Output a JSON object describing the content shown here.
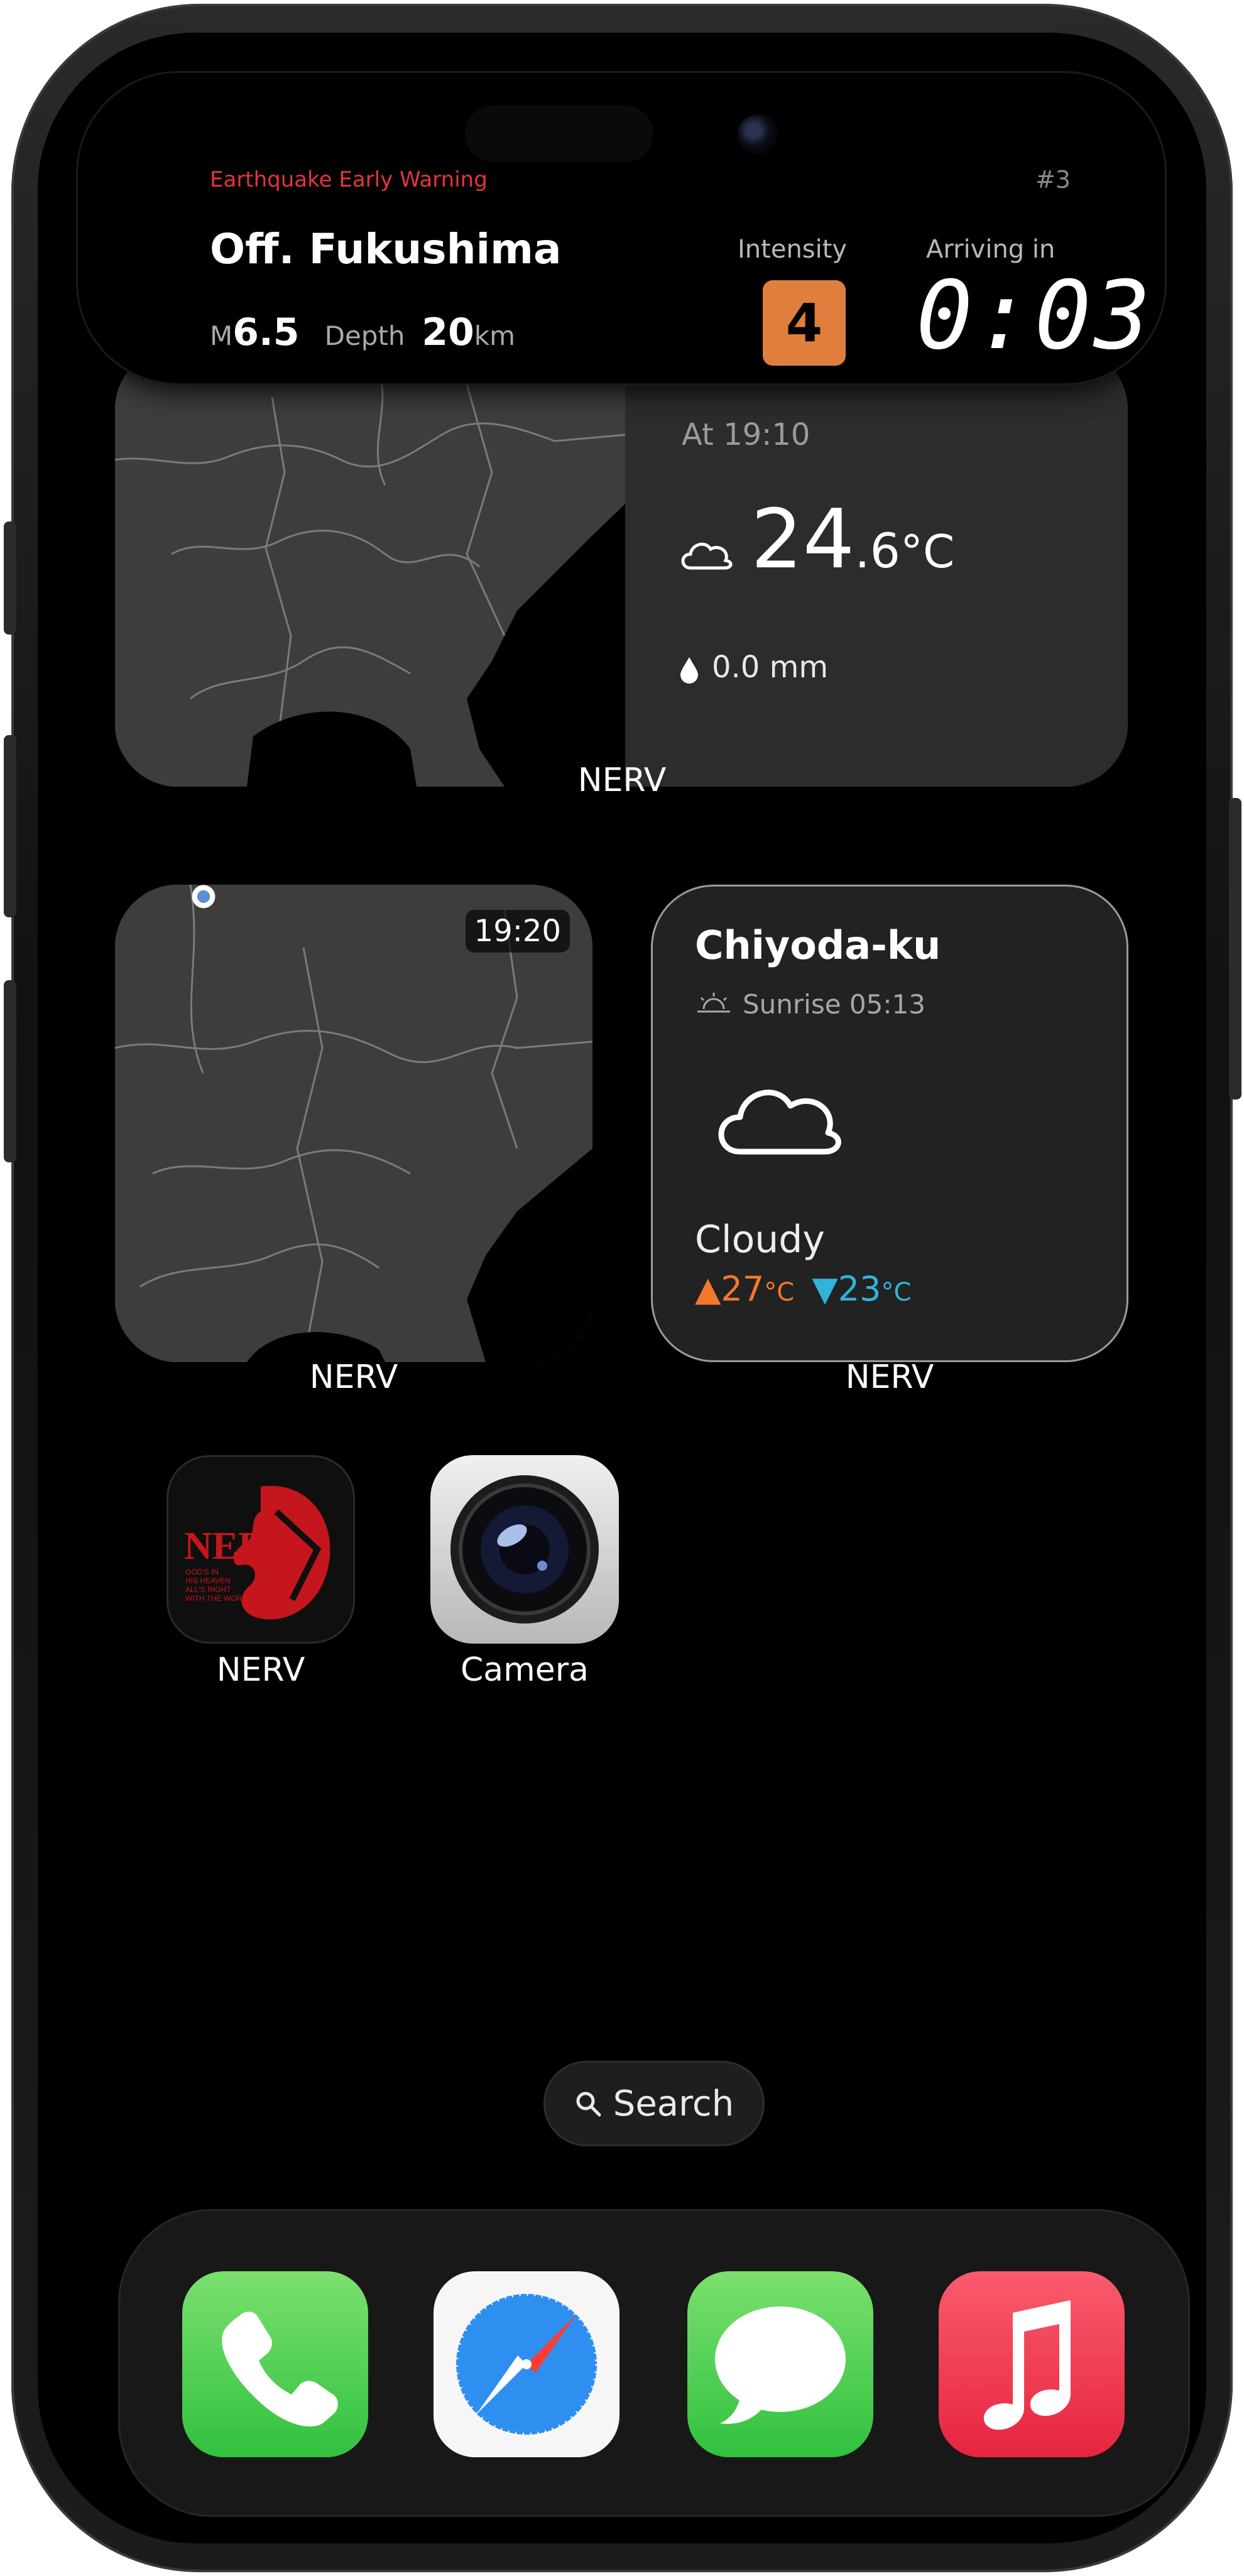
{
  "alert": {
    "label": "Earthquake Early Warning",
    "number": "#3",
    "location": "Off. Fukushima",
    "magnitude_prefix": "M",
    "magnitude": "6.5",
    "depth_label": "Depth",
    "depth": "20",
    "depth_unit": "km",
    "intensity_label": "Intensity",
    "intensity": "4",
    "arriving_label": "Arriving in",
    "countdown": "0:03"
  },
  "widget_large": {
    "time": "At 19:10",
    "temp_int": "24",
    "temp_dec": ".6",
    "temp_unit": "°C",
    "rain": "0.0",
    "rain_unit": "mm",
    "caption": "NERV"
  },
  "widget_map": {
    "time": "19:20",
    "caption": "NERV"
  },
  "widget_weather": {
    "city": "Chiyoda-ku",
    "sunrise": "Sunrise 05:13",
    "condition": "Cloudy",
    "high": "27",
    "low": "23",
    "unit": "°C",
    "caption": "NERV"
  },
  "apps": {
    "nerv": "NERV",
    "camera": "Camera"
  },
  "search": {
    "label": "Search"
  },
  "dock": {
    "icons": [
      "phone-icon",
      "safari-icon",
      "messages-icon",
      "music-icon"
    ]
  },
  "colors": {
    "alert_red": "#e4353a",
    "intensity_orange": "#e07f3d",
    "high_temp": "#f3782d",
    "low_temp": "#32b3dc",
    "map_land": "#3d3d3d"
  }
}
